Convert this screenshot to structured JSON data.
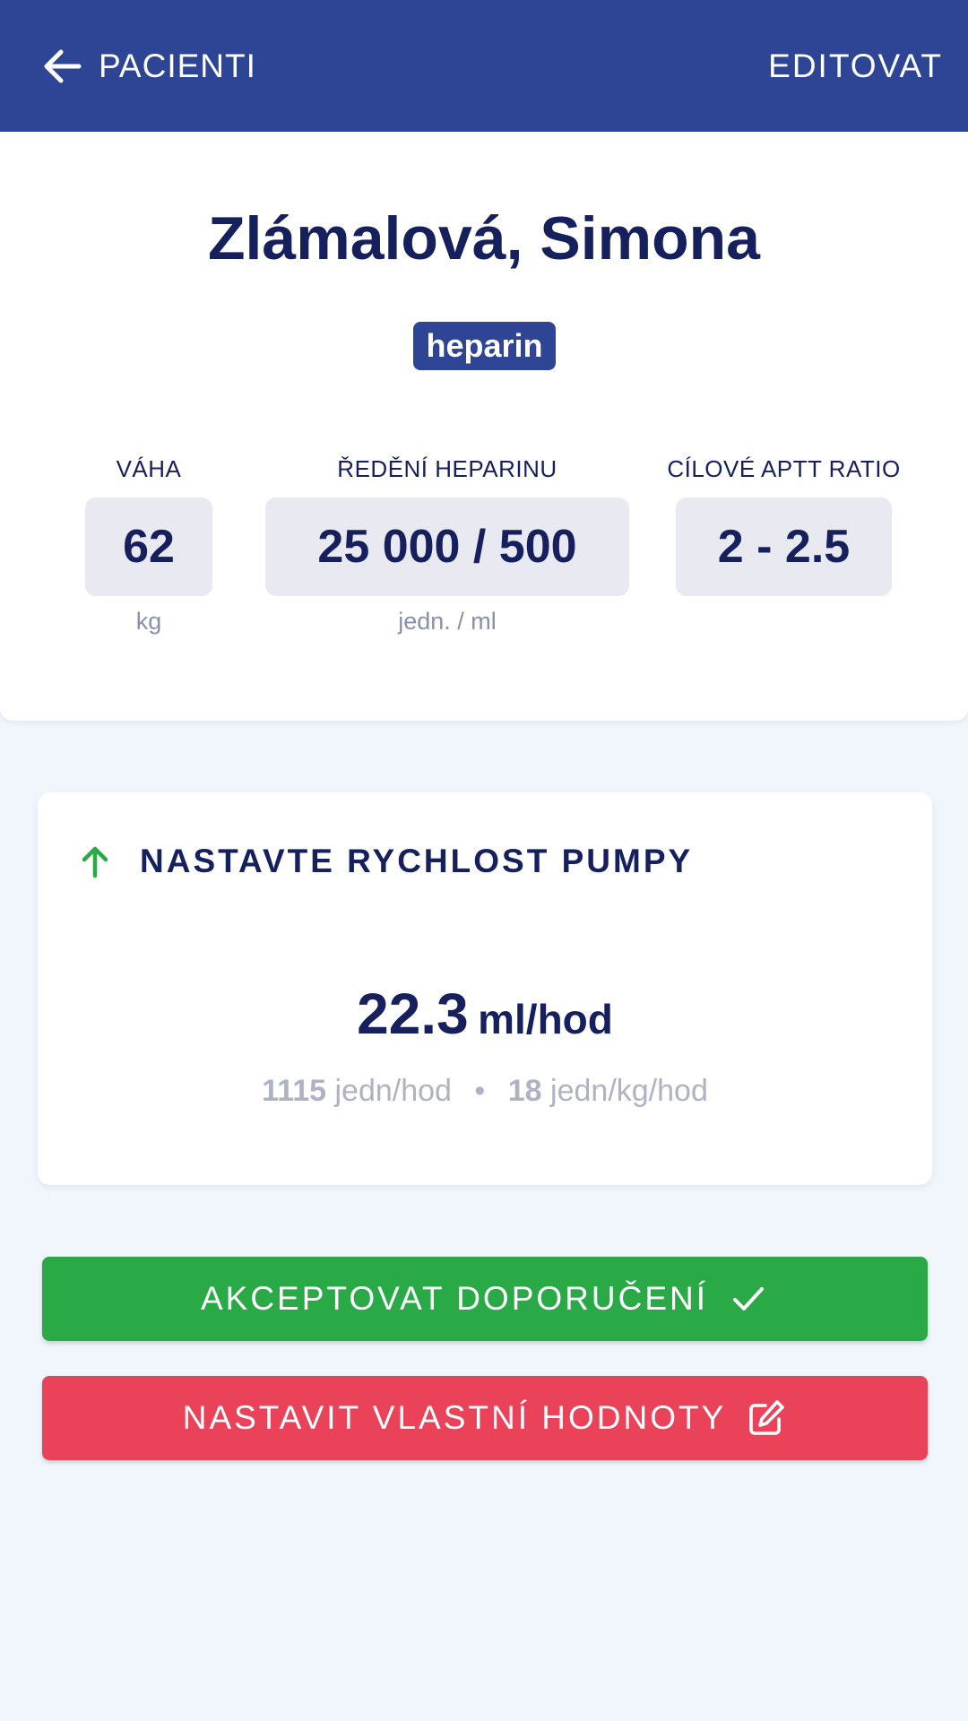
{
  "header": {
    "back_label": "PACIENTI",
    "edit_label": "EDITOVAT",
    "background": "#2e4596"
  },
  "patient": {
    "name": "Zlámalová, Simona",
    "drug": "heparin"
  },
  "params": {
    "weight": {
      "label": "VÁHA",
      "value": "62",
      "unit": "kg"
    },
    "dilution": {
      "label": "ŘEDĚNÍ HEPARINU",
      "value": "25 000 / 500",
      "unit": "jedn. / ml"
    },
    "target": {
      "label": "CÍLOVÉ APTT RATIO",
      "value": "2 - 2.5"
    }
  },
  "recommendation": {
    "title": "NASTAVTE RYCHLOST PUMPY",
    "direction_icon": "arrow-up-icon",
    "rate_value": "22.3",
    "rate_unit": "ml/hod",
    "units_per_hour_value": "1115",
    "units_per_hour_unit": "jedn/hod",
    "units_per_kg_value": "18",
    "units_per_kg_unit": "jedn/kg/hod",
    "separator": "•"
  },
  "actions": {
    "accept_label": "AKCEPTOVAT DOPORUČENÍ",
    "custom_label": "NASTAVIT VLASTNÍ HODNOTY"
  },
  "colors": {
    "primary": "#2e4596",
    "text": "#15205c",
    "accept": "#29aa47",
    "custom": "#ea4258",
    "arrow_up": "#29aa47",
    "page_background": "#f1f5fc"
  }
}
